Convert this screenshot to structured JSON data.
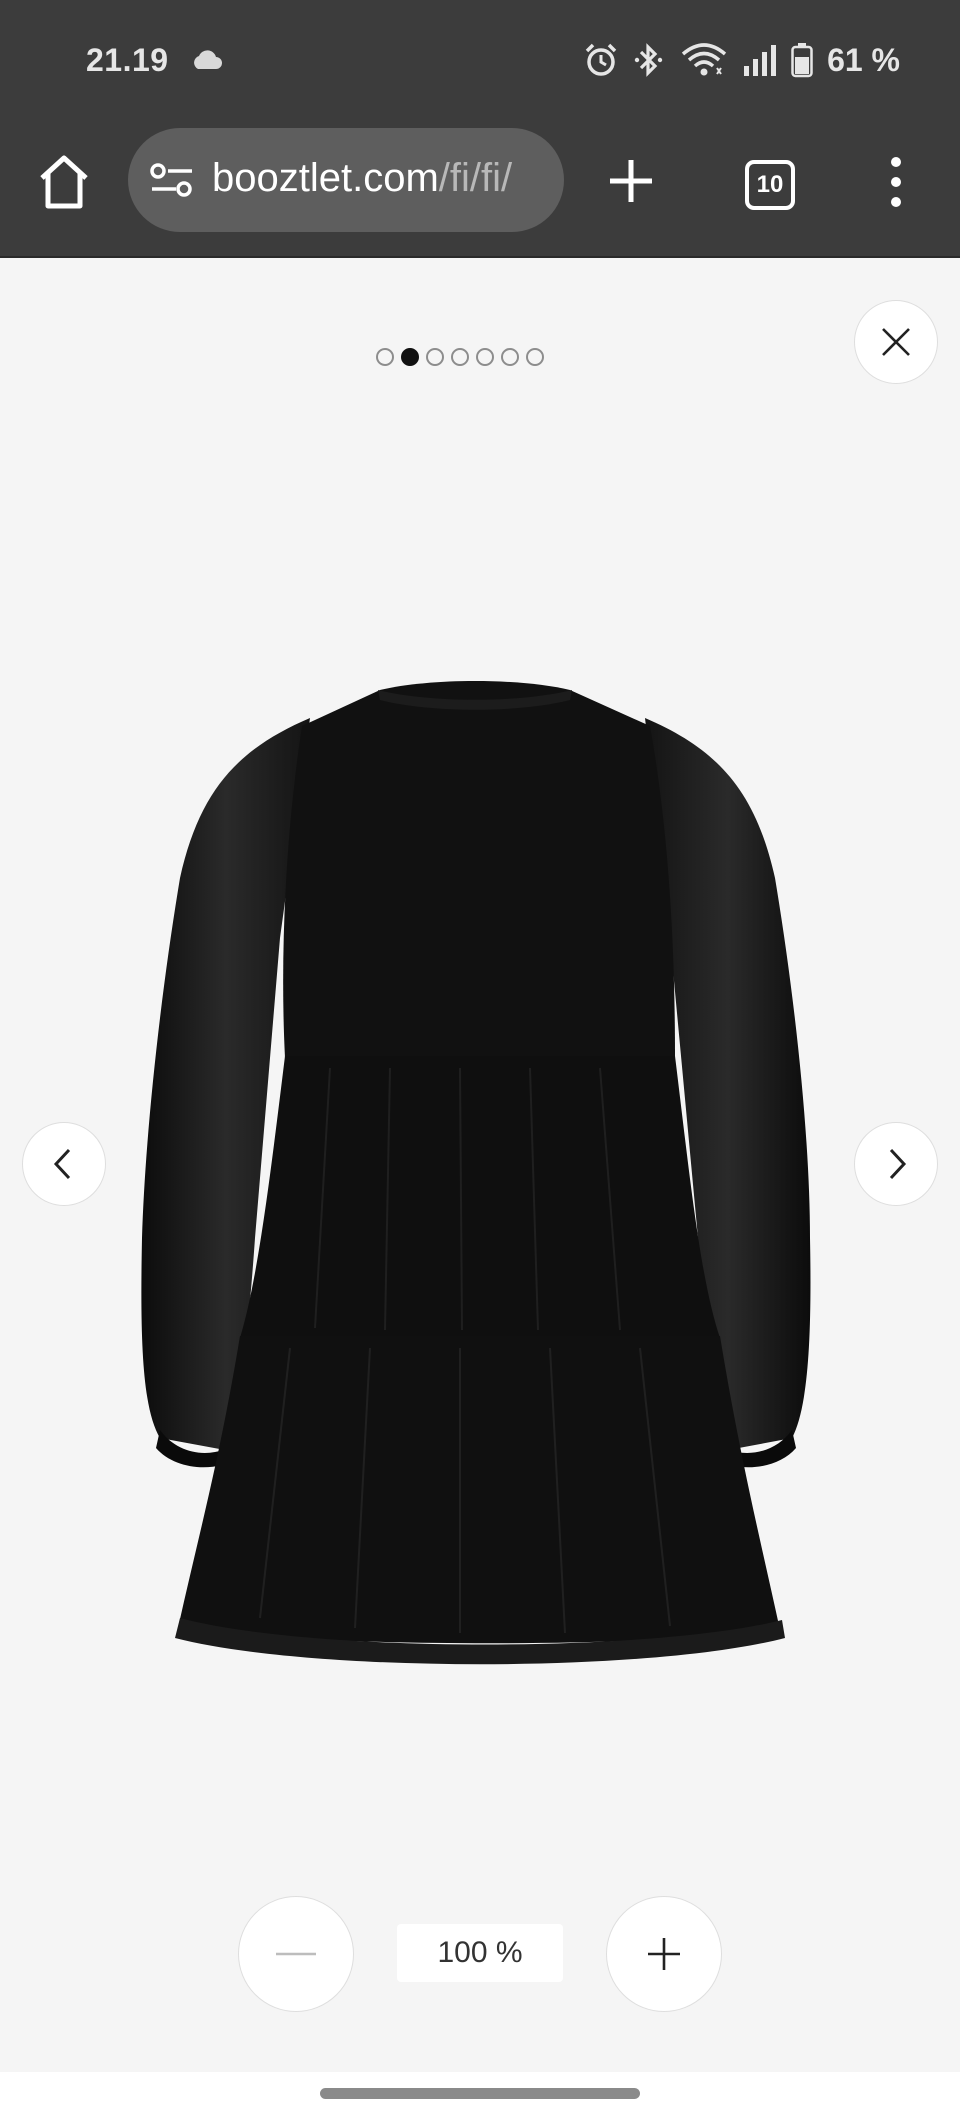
{
  "status_bar": {
    "time": "21.19",
    "weather_icon": "cloud-icon",
    "icons": [
      "alarm-icon",
      "bluetooth-icon",
      "wifi-icon",
      "signal-icon",
      "battery-icon"
    ],
    "battery": "61 %"
  },
  "browser": {
    "url_host": "booztlet.com",
    "url_path": "/fi/fi/",
    "tab_count": "10",
    "icons": [
      "home-icon",
      "site-settings-icon",
      "new-tab-plus-icon",
      "tab-switcher-icon",
      "more-menu-icon"
    ]
  },
  "viewer": {
    "image_count": 7,
    "current_image": 2,
    "image_subject": "black long-sleeve tiered dress, back view",
    "zoom": {
      "level": "100 %"
    },
    "colors": {
      "background": "#f5f5f5",
      "dot_active": "#111111",
      "dot_inactive": "#8d8d8d"
    }
  }
}
